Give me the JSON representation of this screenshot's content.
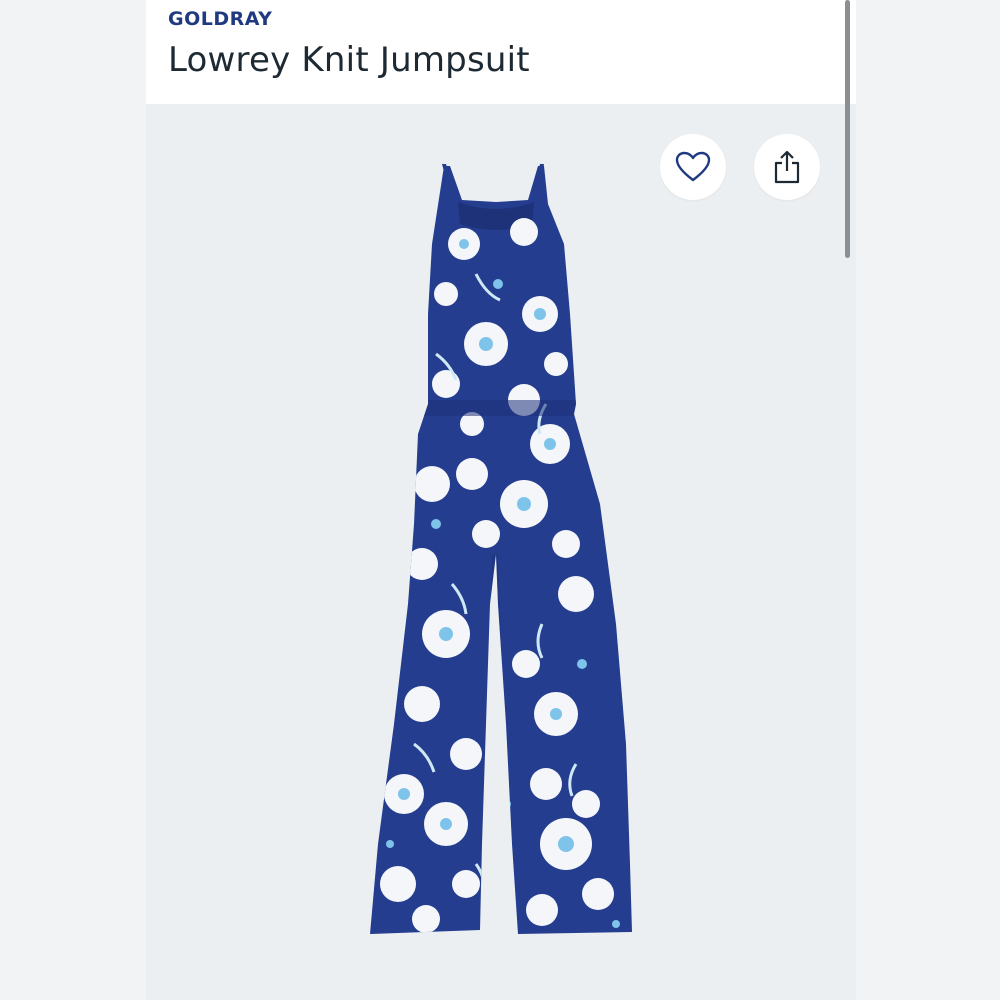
{
  "header": {
    "brand": "GOLDRAY",
    "title": "Lowrey Knit Jumpsuit"
  },
  "actions": {
    "favorite_icon": "heart-outline-icon",
    "share_icon": "share-icon"
  },
  "product_image": {
    "subject": "navy floral halter jumpsuit",
    "colors": {
      "fabric": "#243d8f",
      "flower": "#f4f6fa",
      "flower_accent": "#7ec4ea",
      "background": "#eceff1"
    }
  }
}
